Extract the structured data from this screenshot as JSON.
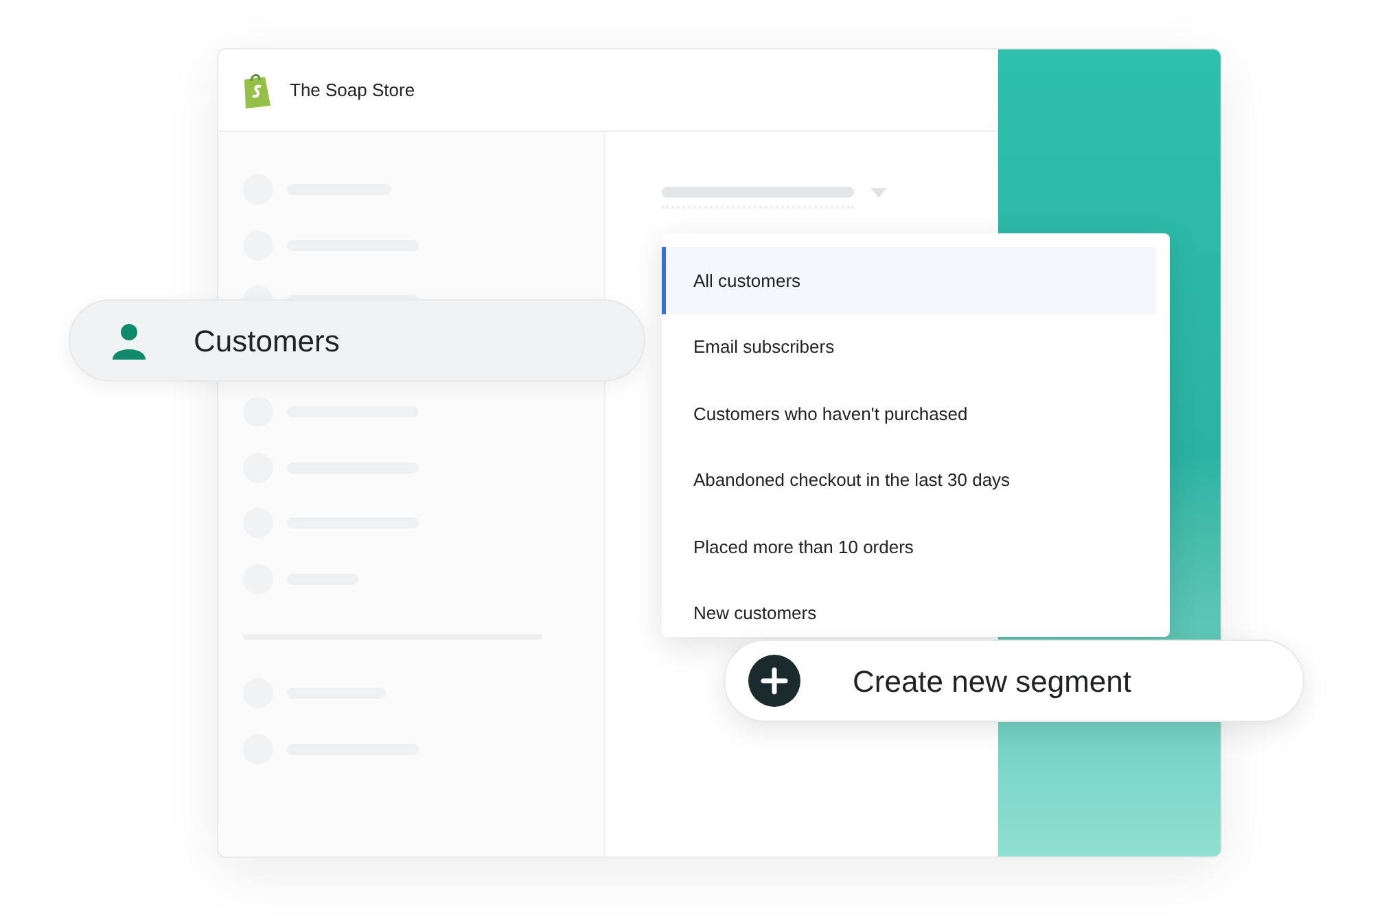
{
  "window": {
    "title": "The Soap Store"
  },
  "nav_highlight": {
    "label": "Customers"
  },
  "segments": [
    {
      "label": "All customers",
      "selected": true
    },
    {
      "label": "Email subscribers",
      "selected": false
    },
    {
      "label": "Customers who haven't purchased",
      "selected": false
    },
    {
      "label": "Abandoned checkout in the last 30 days",
      "selected": false
    },
    {
      "label": "Placed more than 10 orders",
      "selected": false
    },
    {
      "label": "New customers",
      "selected": false
    }
  ],
  "create_button": {
    "label": "Create new segment"
  }
}
